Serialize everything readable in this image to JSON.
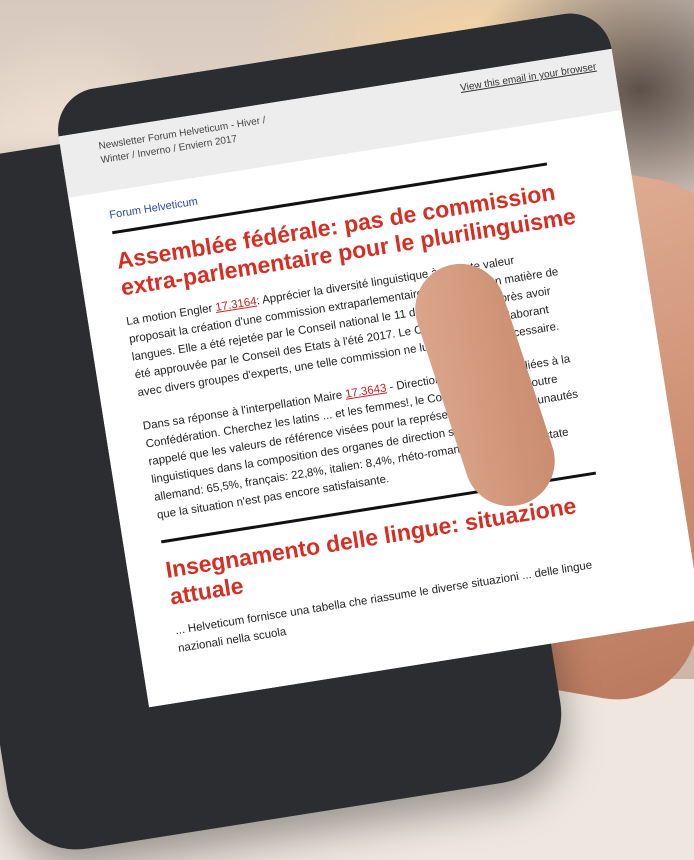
{
  "email": {
    "subject": "Newsletter Forum Helveticum - Hiver / Winter / Inverno / Enviern 2017",
    "view_link": "View this email in your browser",
    "brand": "Forum Helveticum"
  },
  "article1": {
    "title": "Assemblée fédérale: pas de commission extra-parlementaire pour le plurilinguisme",
    "p1_before": "La motion Engler ",
    "p1_ref": "17.3164",
    "p1_after": ": Apprécier la diversité linguistique à sa juste valeur proposait la création d'une commission extraparlementaire compétente en matière de langues. Elle a été rejetée par le Conseil national le 11 décembre 2017, après avoir été approuvée par le Conseil des Etats à l'été 2017. Le Conseil fédéral collaborant avec divers groupes d'experts, une telle commission ne lui semblait pas nécessaire.",
    "p2_before": "Dans sa réponse à l'interpellation Maire ",
    "p2_ref": "17.3643",
    "p2_after": " - Direction des entreprises liées à la Confédération. Cherchez les latins ... et les femmes!, le Conseil fédéral a en outre rappelé que les valeurs de référence visées pour la représentation des communautés linguistiques dans la composition des organes de direction sont les suivantes: allemand: 65,5%, français: 22,8%, italien: 8,4%, rhéto-romanche: 0,6%. Il constate que la situation n'est pas encore satisfaisante."
  },
  "article2": {
    "title": "Insegnamento delle lingue: situazione attuale",
    "p1": "... Helveticum fornisce una tabella che riassume le diverse situazioni ... delle lingue nazionali nella scuola"
  }
}
